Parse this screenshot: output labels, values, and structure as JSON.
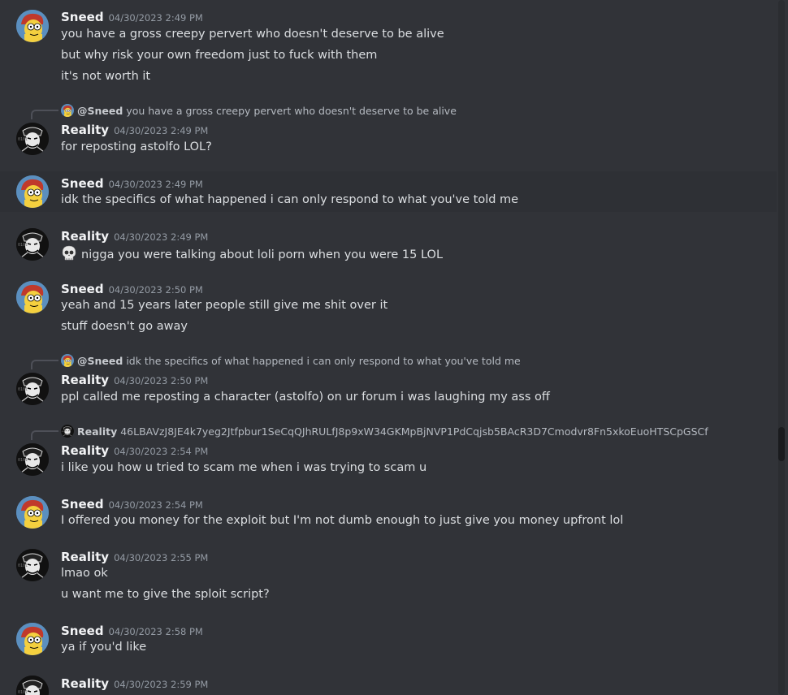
{
  "colors": {
    "background": "#313338",
    "username": "#f2f3f5",
    "timestamp": "#949ba4",
    "text": "#dbdee1",
    "highlight": "#2e3035"
  },
  "messages": [
    {
      "author": "Sneed",
      "time": "04/30/2023 2:49 PM",
      "lines": [
        "you have a gross creepy pervert who doesn't deserve to be alive",
        "but why risk your own freedom just to fuck with them",
        "it's not worth it"
      ]
    },
    {
      "reply_to": {
        "name": "@Sneed",
        "text": "you have a gross creepy pervert who doesn't deserve to be alive"
      },
      "author": "Reality",
      "time": "04/30/2023 2:49 PM",
      "lines": [
        "for reposting astolfo LOL?"
      ]
    },
    {
      "author": "Sneed",
      "time": "04/30/2023 2:49 PM",
      "lines": [
        "idk the specifics of what happened i can only respond to what you've told me"
      ]
    },
    {
      "author": "Reality",
      "time": "04/30/2023 2:49 PM",
      "lines": [
        "nigga you were talking about loli porn when you were 15 LOL"
      ],
      "emoji": "skull-emoji"
    },
    {
      "author": "Sneed",
      "time": "04/30/2023 2:50 PM",
      "lines": [
        "yeah and 15 years later people still give me shit over it",
        "stuff doesn't go away"
      ]
    },
    {
      "reply_to": {
        "name": "@Sneed",
        "text": "idk the specifics of what happened i can only respond to what you've told me"
      },
      "author": "Reality",
      "time": "04/30/2023 2:50 PM",
      "lines": [
        "ppl called me reposting a character (astolfo) on ur forum i was laughing my ass off"
      ]
    },
    {
      "reply_to": {
        "name": "Reality",
        "text": "46LBAVzJ8JE4k7yeg2Jtfpbur1SeCqQJhRULfJ8p9xW34GKMpBjNVP1PdCqjsb5BAcR3D7Cmodvr8Fn5xkoEuoHTSCpGSCf"
      },
      "author": "Reality",
      "time": "04/30/2023 2:54 PM",
      "lines": [
        "i like you how u tried to scam me when i was trying to scam u"
      ]
    },
    {
      "author": "Sneed",
      "time": "04/30/2023 2:54 PM",
      "lines": [
        "I offered you money for the exploit but I'm not dumb enough to just give you money upfront lol"
      ]
    },
    {
      "author": "Reality",
      "time": "04/30/2023 2:55 PM",
      "lines": [
        "lmao ok",
        "u want me to give the sploit script?"
      ]
    },
    {
      "author": "Sneed",
      "time": "04/30/2023 2:58 PM",
      "lines": [
        "ya if you'd like"
      ]
    },
    {
      "author": "Reality",
      "time": "04/30/2023 2:59 PM",
      "lines": []
    }
  ]
}
